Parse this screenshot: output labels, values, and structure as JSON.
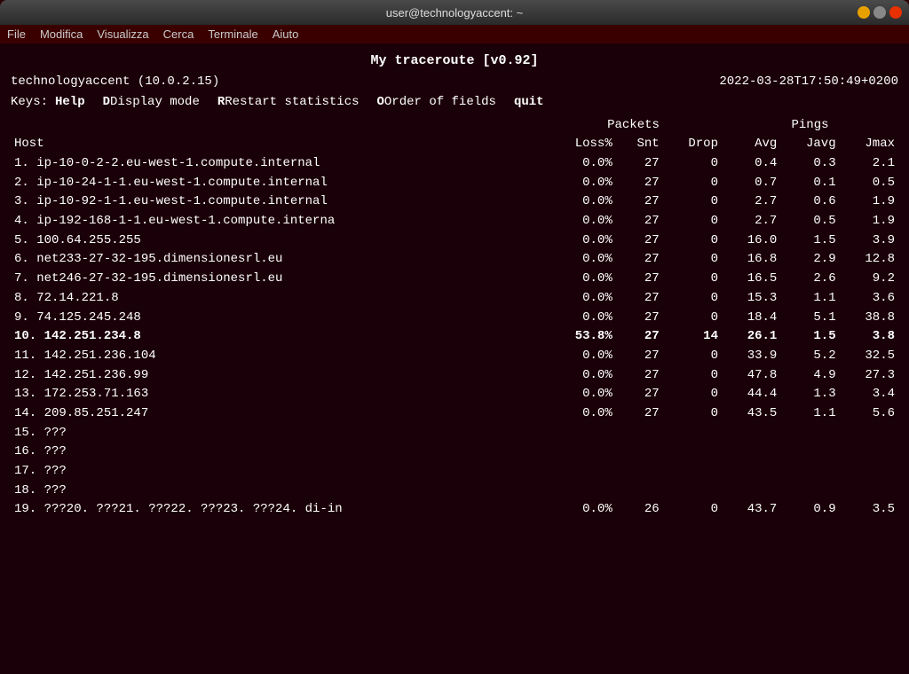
{
  "window": {
    "title": "user@technologyaccent: ~",
    "controls": [
      "minimize",
      "maximize",
      "close"
    ]
  },
  "menubar": {
    "items": [
      "File",
      "Modifica",
      "Visualizza",
      "Cerca",
      "Terminale",
      "Aiuto"
    ]
  },
  "terminal": {
    "title": "My traceroute  [v0.92]",
    "hostname": "technologyaccent (10.0.2.15)",
    "timestamp": "2022-03-28T17:50:49+0200",
    "keys_label": "Keys:",
    "key_help": "Help",
    "key_display": "Display mode",
    "key_restart": "Restart statistics",
    "key_order": "Order of fields",
    "key_quit": "quit",
    "table": {
      "group_packets": "Packets",
      "group_pings": "Pings",
      "columns": [
        "Host",
        "Loss%",
        "Snt",
        "Drop",
        "Avg",
        "Javg",
        "Jmax"
      ],
      "rows": [
        {
          "num": "1.",
          "host": "ip-10-0-2-2.eu-west-1.compute.internal",
          "loss": "0.0%",
          "snt": "27",
          "drop": "0",
          "avg": "0.4",
          "javg": "0.3",
          "jmax": "2.1",
          "bold": false
        },
        {
          "num": "2.",
          "host": "ip-10-24-1-1.eu-west-1.compute.internal",
          "loss": "0.0%",
          "snt": "27",
          "drop": "0",
          "avg": "0.7",
          "javg": "0.1",
          "jmax": "0.5",
          "bold": false
        },
        {
          "num": "3.",
          "host": "ip-10-92-1-1.eu-west-1.compute.internal",
          "loss": "0.0%",
          "snt": "27",
          "drop": "0",
          "avg": "2.7",
          "javg": "0.6",
          "jmax": "1.9",
          "bold": false
        },
        {
          "num": "4.",
          "host": "ip-192-168-1-1.eu-west-1.compute.interna",
          "loss": "0.0%",
          "snt": "27",
          "drop": "0",
          "avg": "2.7",
          "javg": "0.5",
          "jmax": "1.9",
          "bold": false
        },
        {
          "num": "5.",
          "host": "100.64.255.255",
          "loss": "0.0%",
          "snt": "27",
          "drop": "0",
          "avg": "16.0",
          "javg": "1.5",
          "jmax": "3.9",
          "bold": false
        },
        {
          "num": "6.",
          "host": "net233-27-32-195.dimensionesrl.eu",
          "loss": "0.0%",
          "snt": "27",
          "drop": "0",
          "avg": "16.8",
          "javg": "2.9",
          "jmax": "12.8",
          "bold": false
        },
        {
          "num": "7.",
          "host": "net246-27-32-195.dimensionesrl.eu",
          "loss": "0.0%",
          "snt": "27",
          "drop": "0",
          "avg": "16.5",
          "javg": "2.6",
          "jmax": "9.2",
          "bold": false
        },
        {
          "num": "8.",
          "host": "72.14.221.8",
          "loss": "0.0%",
          "snt": "27",
          "drop": "0",
          "avg": "15.3",
          "javg": "1.1",
          "jmax": "3.6",
          "bold": false
        },
        {
          "num": "9.",
          "host": "74.125.245.248",
          "loss": "0.0%",
          "snt": "27",
          "drop": "0",
          "avg": "18.4",
          "javg": "5.1",
          "jmax": "38.8",
          "bold": false
        },
        {
          "num": "10.",
          "host": "142.251.234.8",
          "loss": "53.8%",
          "snt": "27",
          "drop": "14",
          "avg": "26.1",
          "javg": "1.5",
          "jmax": "3.8",
          "bold": true
        },
        {
          "num": "11.",
          "host": "142.251.236.104",
          "loss": "0.0%",
          "snt": "27",
          "drop": "0",
          "avg": "33.9",
          "javg": "5.2",
          "jmax": "32.5",
          "bold": false
        },
        {
          "num": "12.",
          "host": "142.251.236.99",
          "loss": "0.0%",
          "snt": "27",
          "drop": "0",
          "avg": "47.8",
          "javg": "4.9",
          "jmax": "27.3",
          "bold": false
        },
        {
          "num": "13.",
          "host": "172.253.71.163",
          "loss": "0.0%",
          "snt": "27",
          "drop": "0",
          "avg": "44.4",
          "javg": "1.3",
          "jmax": "3.4",
          "bold": false
        },
        {
          "num": "14.",
          "host": "209.85.251.247",
          "loss": "0.0%",
          "snt": "27",
          "drop": "0",
          "avg": "43.5",
          "javg": "1.1",
          "jmax": "5.6",
          "bold": false
        },
        {
          "num": "15.",
          "host": "???",
          "loss": "",
          "snt": "",
          "drop": "",
          "avg": "",
          "javg": "",
          "jmax": "",
          "bold": false
        },
        {
          "num": "16.",
          "host": "???",
          "loss": "",
          "snt": "",
          "drop": "",
          "avg": "",
          "javg": "",
          "jmax": "",
          "bold": false
        },
        {
          "num": "17.",
          "host": "???",
          "loss": "",
          "snt": "",
          "drop": "",
          "avg": "",
          "javg": "",
          "jmax": "",
          "bold": false
        },
        {
          "num": "18.",
          "host": "???",
          "loss": "",
          "snt": "",
          "drop": "",
          "avg": "",
          "javg": "",
          "jmax": "",
          "bold": false
        },
        {
          "num": "19.",
          "host": "???20. ???21. ???22. ???23. ???24. di-in",
          "loss": "0.0%",
          "snt": "26",
          "drop": "0",
          "avg": "43.7",
          "javg": "0.9",
          "jmax": "3.5",
          "bold": false
        }
      ]
    }
  }
}
